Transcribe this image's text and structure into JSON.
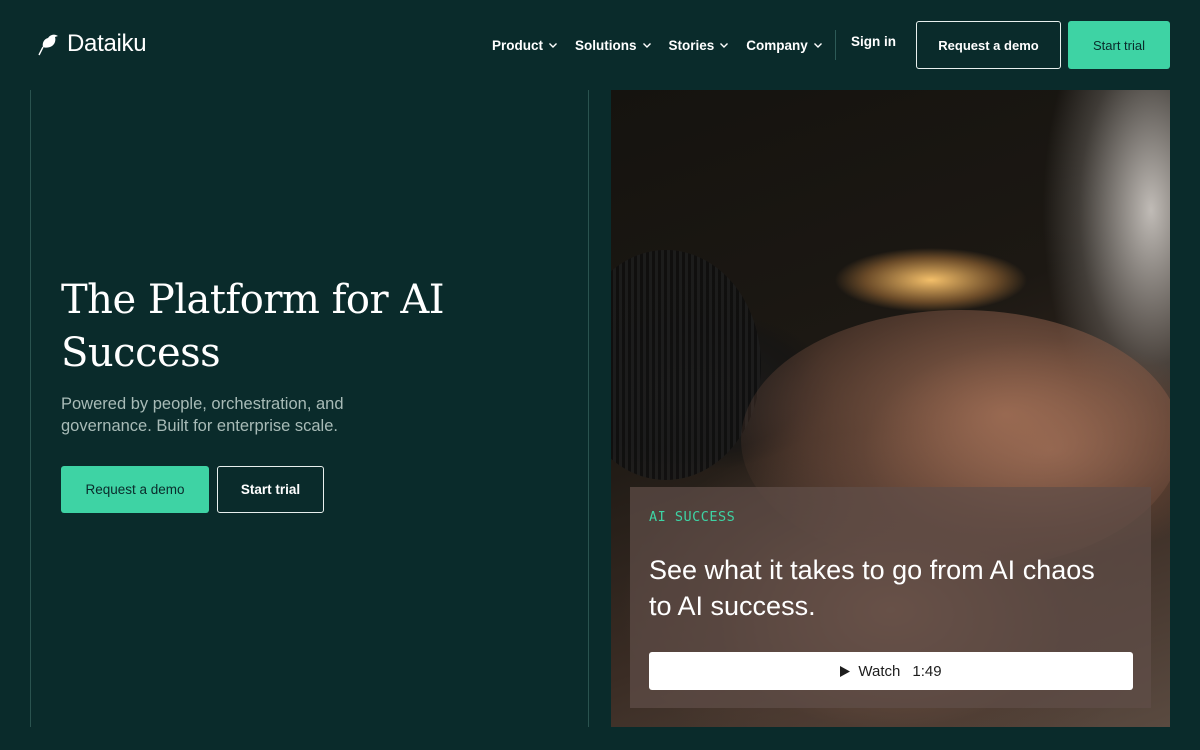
{
  "brand": {
    "name": "Dataiku",
    "logo_icon": "bird-icon"
  },
  "nav": {
    "items": [
      {
        "label": "Product",
        "icon": "chevron-down-icon"
      },
      {
        "label": "Solutions",
        "icon": "chevron-down-icon"
      },
      {
        "label": "Stories",
        "icon": "chevron-down-icon"
      },
      {
        "label": "Company",
        "icon": "chevron-down-icon"
      }
    ],
    "signin_label": "Sign in",
    "request_demo_label": "Request a demo",
    "start_trial_label": "Start trial"
  },
  "hero": {
    "title": "The Platform for AI Success",
    "subtitle": "Powered by people, orchestration, and governance. Built for enterprise scale.",
    "request_demo_label": "Request a demo",
    "start_trial_label": "Start trial"
  },
  "media_card": {
    "tag": "AI SUCCESS",
    "headline": "See what it takes to go from AI chaos to AI success.",
    "watch_label": "Watch",
    "watch_duration": "1:49",
    "play_icon": "play-icon"
  },
  "colors": {
    "background": "#0a2b2b",
    "accent": "#3ed3a4",
    "frame_line": "#2a534f",
    "muted_text": "#a8bbb7"
  }
}
